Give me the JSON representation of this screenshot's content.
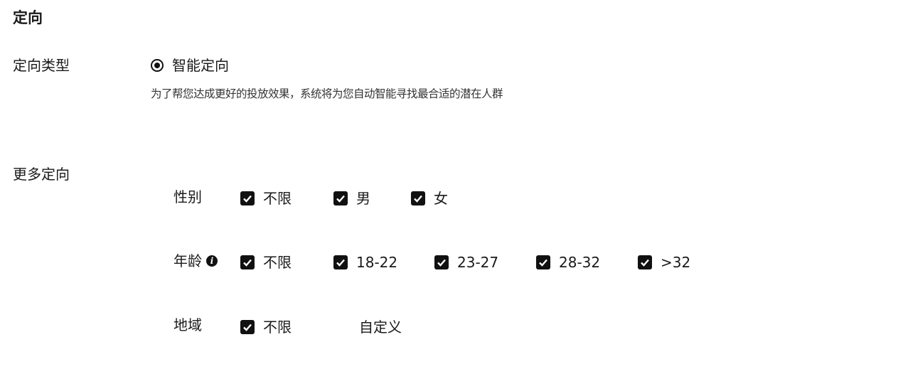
{
  "section": {
    "title": "定向"
  },
  "targeting_type": {
    "label": "定向类型",
    "option": "智能定向",
    "selected": true,
    "hint": "为了帮您达成更好的投放效果，系统将为您自动智能寻找最合适的潜在人群"
  },
  "more_targeting": {
    "label": "更多定向",
    "gender": {
      "label": "性别",
      "options": [
        "不限",
        "男",
        "女"
      ]
    },
    "age": {
      "label": "年龄",
      "info_icon": "info-icon",
      "options": [
        "不限",
        "18-22",
        "23-27",
        "28-32",
        ">32"
      ]
    },
    "region": {
      "label": "地域",
      "options": [
        "不限"
      ],
      "custom_label": "自定义"
    }
  },
  "icons": {
    "checkbox": "checkbox-checked-icon",
    "radio": "radio-selected-icon"
  }
}
